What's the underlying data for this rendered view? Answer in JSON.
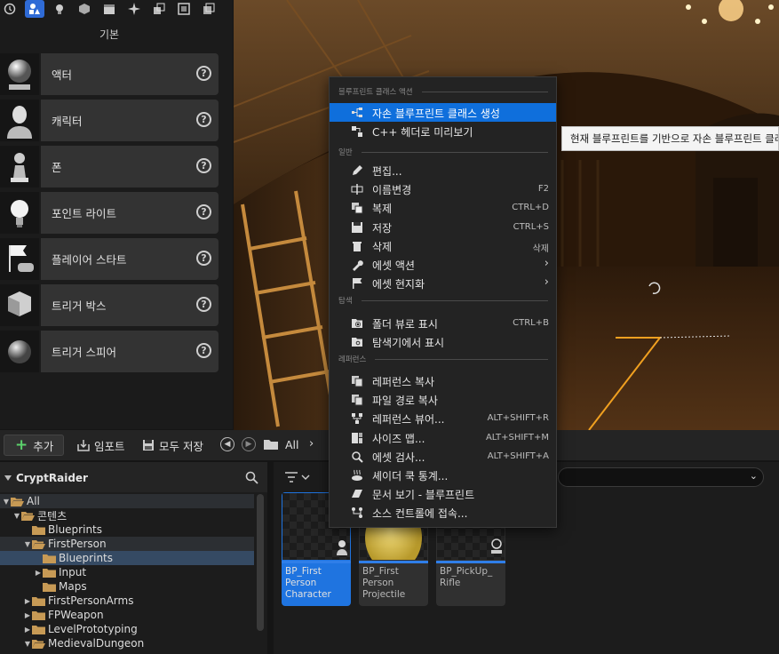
{
  "place_actors": {
    "category_title": "기본",
    "items": [
      {
        "label": "액터",
        "icon": "sphere-actor-icon"
      },
      {
        "label": "캐릭터",
        "icon": "character-icon"
      },
      {
        "label": "폰",
        "icon": "pawn-icon"
      },
      {
        "label": "포인트 라이트",
        "icon": "light-bulb-icon"
      },
      {
        "label": "플레이어 스타트",
        "icon": "player-start-icon"
      },
      {
        "label": "트리거 박스",
        "icon": "trigger-box-icon"
      },
      {
        "label": "트리거 스피어",
        "icon": "trigger-sphere-icon"
      }
    ],
    "help_glyph": "?"
  },
  "viewport": {
    "tooltip": "현재 블루프린트를 기반으로 자손 블루프린트 클래스를 생성합니다"
  },
  "context_menu": {
    "sections": [
      {
        "title": "블루프린트 클래스 액션",
        "items": [
          {
            "label": "자손 블루프린트 클래스 생성",
            "shortcut": "",
            "submenu": false,
            "highlighted": true,
            "icon": "child-class-icon"
          },
          {
            "label": "C++ 헤더로 미리보기",
            "shortcut": "",
            "submenu": false,
            "highlighted": false,
            "icon": "cpp-header-icon"
          }
        ]
      },
      {
        "title": "일반",
        "items": [
          {
            "label": "편집...",
            "shortcut": "",
            "submenu": false,
            "highlighted": false,
            "icon": "pencil-icon"
          },
          {
            "label": "이름변경",
            "shortcut": "F2",
            "submenu": false,
            "highlighted": false,
            "icon": "rename-icon"
          },
          {
            "label": "복제",
            "shortcut": "CTRL+D",
            "submenu": false,
            "highlighted": false,
            "icon": "duplicate-icon"
          },
          {
            "label": "저장",
            "shortcut": "CTRL+S",
            "submenu": false,
            "highlighted": false,
            "icon": "save-icon"
          },
          {
            "label": "삭제",
            "shortcut": "삭제",
            "submenu": false,
            "highlighted": false,
            "icon": "trash-icon"
          },
          {
            "label": "에셋 액션",
            "shortcut": "",
            "submenu": true,
            "highlighted": false,
            "icon": "wrench-icon"
          },
          {
            "label": "에셋 현지화",
            "shortcut": "",
            "submenu": true,
            "highlighted": false,
            "icon": "flag-icon"
          }
        ]
      },
      {
        "title": "탐색",
        "items": [
          {
            "label": "폴더 뷰로 표시",
            "shortcut": "CTRL+B",
            "submenu": false,
            "highlighted": false,
            "icon": "folder-search-icon"
          },
          {
            "label": "탐색기에서 표시",
            "shortcut": "",
            "submenu": false,
            "highlighted": false,
            "icon": "explorer-icon"
          }
        ]
      },
      {
        "title": "레퍼런스",
        "items": [
          {
            "label": "레퍼런스 복사",
            "shortcut": "",
            "submenu": false,
            "highlighted": false,
            "icon": "copy-reference-icon"
          },
          {
            "label": "파일 경로 복사",
            "shortcut": "",
            "submenu": false,
            "highlighted": false,
            "icon": "copy-path-icon"
          },
          {
            "label": "레퍼런스 뷰어...",
            "shortcut": "ALT+SHIFT+R",
            "submenu": false,
            "highlighted": false,
            "icon": "reference-viewer-icon"
          },
          {
            "label": "사이즈 맵...",
            "shortcut": "ALT+SHIFT+M",
            "submenu": false,
            "highlighted": false,
            "icon": "size-map-icon"
          },
          {
            "label": "에셋 검사...",
            "shortcut": "ALT+SHIFT+A",
            "submenu": false,
            "highlighted": false,
            "icon": "audit-icon"
          },
          {
            "label": "셰이더 쿡 통계...",
            "shortcut": "",
            "submenu": false,
            "highlighted": false,
            "icon": "shader-stats-icon"
          },
          {
            "label": "문서 보기 - 블루프린트",
            "shortcut": "",
            "submenu": false,
            "highlighted": false,
            "icon": "docs-icon"
          },
          {
            "label": "소스 컨트롤에 접속...",
            "shortcut": "",
            "submenu": false,
            "highlighted": false,
            "icon": "source-control-icon"
          }
        ]
      }
    ]
  },
  "content_browser": {
    "toolbar": {
      "add_label": "추가",
      "import_label": "임포트",
      "save_all_label": "모두 저장",
      "path_root": "All",
      "path_chevron": "›"
    },
    "sources": {
      "project_title": "CryptRaider",
      "tree": [
        {
          "label": "All",
          "depth": 0,
          "arrow": "▼",
          "band": true,
          "selected": false
        },
        {
          "label": "콘텐츠",
          "depth": 1,
          "arrow": "▼",
          "band": false,
          "selected": false
        },
        {
          "label": "Blueprints",
          "depth": 2,
          "arrow": "",
          "band": false,
          "selected": false
        },
        {
          "label": "FirstPerson",
          "depth": 2,
          "arrow": "▼",
          "band": true,
          "selected": false
        },
        {
          "label": "Blueprints",
          "depth": 3,
          "arrow": "",
          "band": false,
          "selected": true
        },
        {
          "label": "Input",
          "depth": 3,
          "arrow": "▶",
          "band": false,
          "selected": false
        },
        {
          "label": "Maps",
          "depth": 3,
          "arrow": "",
          "band": false,
          "selected": false
        },
        {
          "label": "FirstPersonArms",
          "depth": 2,
          "arrow": "▶",
          "band": false,
          "selected": false
        },
        {
          "label": "FPWeapon",
          "depth": 2,
          "arrow": "▶",
          "band": false,
          "selected": false
        },
        {
          "label": "LevelPrototyping",
          "depth": 2,
          "arrow": "▶",
          "band": false,
          "selected": false
        },
        {
          "label": "MedievalDungeon",
          "depth": 2,
          "arrow": "▼",
          "band": false,
          "selected": false
        }
      ]
    },
    "assets": [
      {
        "name": "BP_First Person Character",
        "lines": [
          "BP_First",
          "Person",
          "Character"
        ],
        "selected": true,
        "thumb": "character-thumb"
      },
      {
        "name": "BP_First Person Projectile",
        "lines": [
          "BP_First",
          "Person",
          "Projectile"
        ],
        "selected": false,
        "thumb": "sphere-thumb"
      },
      {
        "name": "BP_PickUp_Rifle",
        "lines": [
          "BP_PickUp_",
          "Rifle"
        ],
        "selected": false,
        "thumb": "rifle-thumb"
      }
    ]
  },
  "colors": {
    "accent": "#0f6fdc",
    "panel": "#1b1b1b",
    "item": "#333333",
    "add_plus": "#5bd26b",
    "folder": "#c79a55",
    "lava_line": "#f0a020"
  }
}
